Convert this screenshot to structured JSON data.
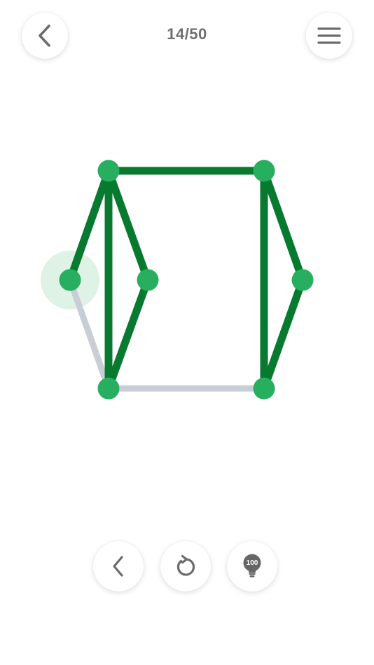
{
  "header": {
    "level_text": "14/50",
    "back_icon": "chevron-left-icon",
    "menu_icon": "hamburger-menu-icon"
  },
  "puzzle": {
    "colors": {
      "drawn_edge": "#087a30",
      "undrawn_edge": "#c9ced6",
      "node": "#27ae5f",
      "active_halo": "#dff2e6"
    },
    "nodes": [
      {
        "id": "top-left"
      },
      {
        "id": "top-right"
      },
      {
        "id": "mid-left-outer",
        "active": true
      },
      {
        "id": "mid-left-inner"
      },
      {
        "id": "mid-right"
      },
      {
        "id": "bottom-left"
      },
      {
        "id": "bottom-right"
      }
    ],
    "edges": [
      {
        "from": "top-left",
        "to": "top-right",
        "drawn": true
      },
      {
        "from": "top-left",
        "to": "mid-left-outer",
        "drawn": true
      },
      {
        "from": "top-left",
        "to": "mid-left-inner",
        "drawn": true
      },
      {
        "from": "top-left",
        "to": "bottom-left",
        "drawn": true
      },
      {
        "from": "mid-left-inner",
        "to": "bottom-left",
        "drawn": true
      },
      {
        "from": "top-right",
        "to": "bottom-right",
        "drawn": true
      },
      {
        "from": "top-right",
        "to": "mid-right",
        "drawn": true
      },
      {
        "from": "mid-right",
        "to": "bottom-right",
        "drawn": true
      },
      {
        "from": "mid-left-outer",
        "to": "bottom-left",
        "drawn": false
      },
      {
        "from": "bottom-left",
        "to": "bottom-right",
        "drawn": false
      }
    ]
  },
  "controls": {
    "undo_icon": "chevron-left-icon",
    "restart_icon": "restart-icon",
    "hint_icon": "lightbulb-icon",
    "hint_count": "100"
  }
}
